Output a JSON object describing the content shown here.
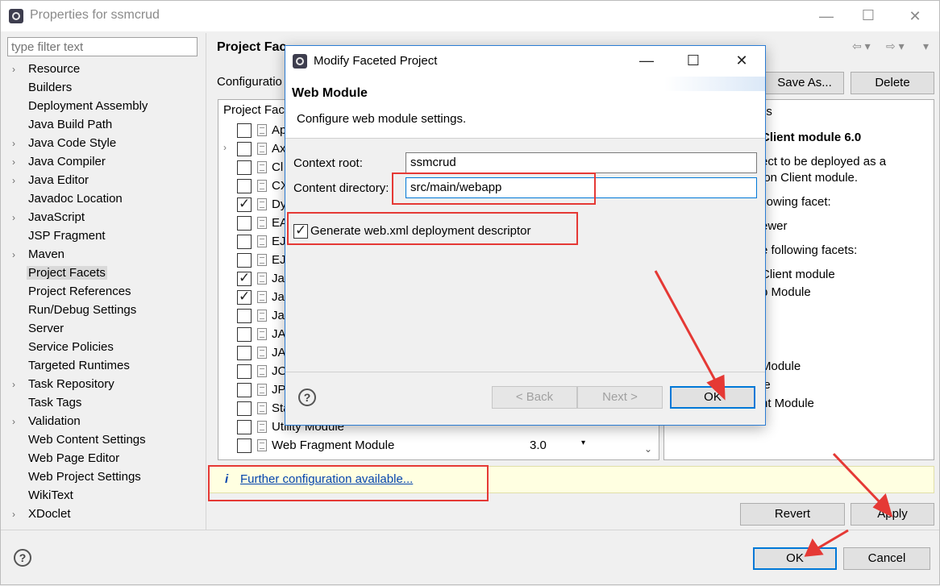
{
  "window": {
    "title": "Properties for ssmcrud",
    "controls": {
      "minimize": "—",
      "maximize": "☐",
      "close": "✕"
    }
  },
  "filter": {
    "placeholder": "type filter text"
  },
  "tree": {
    "items": [
      {
        "label": "Resource",
        "expandable": true
      },
      {
        "label": "Builders",
        "expandable": false
      },
      {
        "label": "Deployment Assembly",
        "expandable": false
      },
      {
        "label": "Java Build Path",
        "expandable": false
      },
      {
        "label": "Java Code Style",
        "expandable": true
      },
      {
        "label": "Java Compiler",
        "expandable": true
      },
      {
        "label": "Java Editor",
        "expandable": true
      },
      {
        "label": "Javadoc Location",
        "expandable": false
      },
      {
        "label": "JavaScript",
        "expandable": true
      },
      {
        "label": "JSP Fragment",
        "expandable": false
      },
      {
        "label": "Maven",
        "expandable": true
      },
      {
        "label": "Project Facets",
        "expandable": false,
        "selected": true
      },
      {
        "label": "Project References",
        "expandable": false
      },
      {
        "label": "Run/Debug Settings",
        "expandable": false
      },
      {
        "label": "Server",
        "expandable": false
      },
      {
        "label": "Service Policies",
        "expandable": false
      },
      {
        "label": "Targeted Runtimes",
        "expandable": false
      },
      {
        "label": "Task Repository",
        "expandable": true
      },
      {
        "label": "Task Tags",
        "expandable": false
      },
      {
        "label": "Validation",
        "expandable": true
      },
      {
        "label": "Web Content Settings",
        "expandable": false
      },
      {
        "label": "Web Page Editor",
        "expandable": false
      },
      {
        "label": "Web Project Settings",
        "expandable": false
      },
      {
        "label": "WikiText",
        "expandable": false
      },
      {
        "label": "XDoclet",
        "expandable": true
      }
    ]
  },
  "page": {
    "title": "Project Fac",
    "config_label": "Configuratio",
    "save_as": "Save As...",
    "delete": "Delete",
    "facets_header": "Project Fac",
    "details_tab": "es",
    "revert": "Revert",
    "apply": "Apply",
    "further_config": "Further configuration available...",
    "info_icon": "i"
  },
  "facets": [
    {
      "name": "Ap",
      "checked": false,
      "expandable": false
    },
    {
      "name": "Ax",
      "checked": false,
      "expandable": true
    },
    {
      "name": "Cl",
      "checked": false,
      "expandable": false
    },
    {
      "name": "CX",
      "checked": false,
      "expandable": false
    },
    {
      "name": "Dy",
      "checked": true,
      "expandable": false
    },
    {
      "name": "EA",
      "checked": false,
      "expandable": false
    },
    {
      "name": "EJ",
      "checked": false,
      "expandable": false
    },
    {
      "name": "EJ",
      "checked": false,
      "expandable": false
    },
    {
      "name": "Jav",
      "checked": true,
      "expandable": false
    },
    {
      "name": "Jav",
      "checked": true,
      "expandable": false
    },
    {
      "name": "Jav",
      "checked": false,
      "expandable": false
    },
    {
      "name": "JA",
      "checked": false,
      "expandable": false
    },
    {
      "name": "JA",
      "checked": false,
      "expandable": false
    },
    {
      "name": "JC",
      "checked": false,
      "expandable": false
    },
    {
      "name": "JP",
      "checked": false,
      "expandable": false
    },
    {
      "name": "Sta",
      "checked": false,
      "expandable": false
    },
    {
      "name": "Utility Module",
      "checked": false,
      "expandable": false
    },
    {
      "name": "Web Fragment Module",
      "checked": false,
      "expandable": false,
      "version": "3.0"
    }
  ],
  "details": {
    "title": "Client module 6.0",
    "lines": [
      "ect to be deployed as a",
      "ion Client module.",
      "llowing facet:",
      "ewer",
      "e following facets:",
      "Client module",
      "b Module",
      "Module",
      "le",
      "nt Module"
    ]
  },
  "modal": {
    "title": "Modify Faceted Project",
    "heading": "Web Module",
    "description": "Configure web module settings.",
    "context_root_label": "Context root:",
    "context_root_value": "ssmcrud",
    "content_dir_label": "Content directory:",
    "content_dir_value": "src/main/webapp",
    "generate_label": "Generate web.xml deployment descriptor",
    "generate_checked": true,
    "back": "< Back",
    "next": "Next >",
    "ok": "OK",
    "help": "?"
  },
  "footer": {
    "ok": "OK",
    "cancel": "Cancel",
    "help": "?"
  },
  "colors": {
    "annotation_red": "#e53935",
    "focus_blue": "#0078d7",
    "info_bg": "#ffffe1",
    "link": "#0645ad"
  }
}
